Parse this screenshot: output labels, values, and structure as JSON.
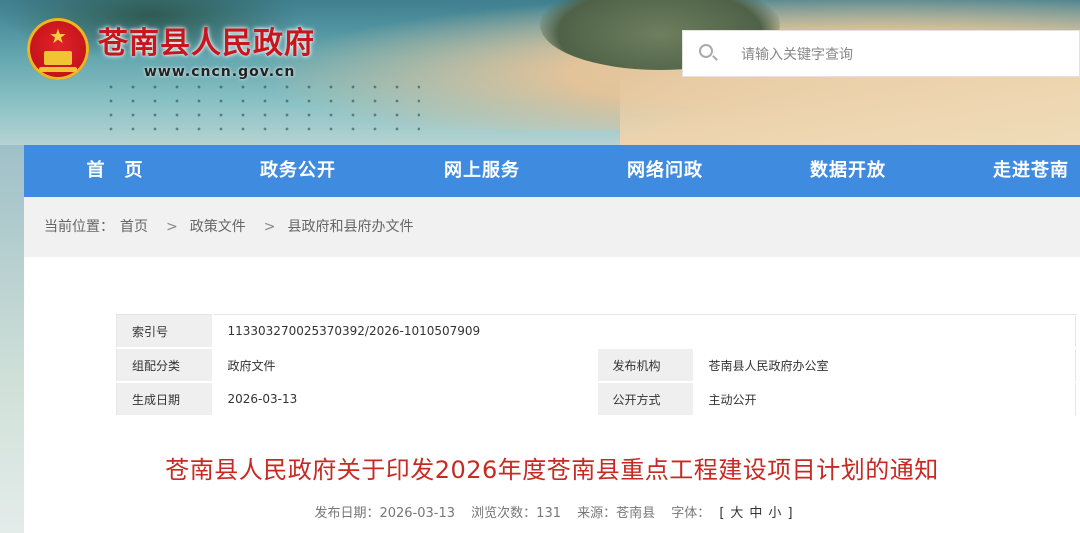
{
  "header": {
    "site_title": "苍南县人民政府",
    "site_url": "www.cncn.gov.cn",
    "search_placeholder": "请输入关键字查询"
  },
  "nav": [
    "首　页",
    "政务公开",
    "网上服务",
    "网络问政",
    "数据开放",
    "走进苍南"
  ],
  "breadcrumb": {
    "prefix": "当前位置：",
    "items": [
      "首页",
      "政策文件",
      "县政府和县府办文件"
    ],
    "separator": ">"
  },
  "meta": {
    "index_label": "索引号",
    "index_value": "113303270025370392/2026-1010507909",
    "category_label": "组配分类",
    "category_value": "政府文件",
    "publisher_label": "发布机构",
    "publisher_value": "苍南县人民政府办公室",
    "date_label": "生成日期",
    "date_value": "2026-03-13",
    "method_label": "公开方式",
    "method_value": "主动公开"
  },
  "document": {
    "title": "苍南县人民政府关于印发2026年度苍南县重点工程建设项目计划的通知",
    "publish_date": "发布日期：2026-03-13",
    "views": "浏览次数：131",
    "source": "来源：苍南县",
    "font_label": "字体：",
    "font_open": "[",
    "font_large": "大",
    "font_medium": "中",
    "font_small": "小",
    "font_close": "]"
  },
  "colors": {
    "nav_bg": "#3f8be0",
    "title_red": "#c62a22",
    "brand_red": "#c7161d"
  }
}
